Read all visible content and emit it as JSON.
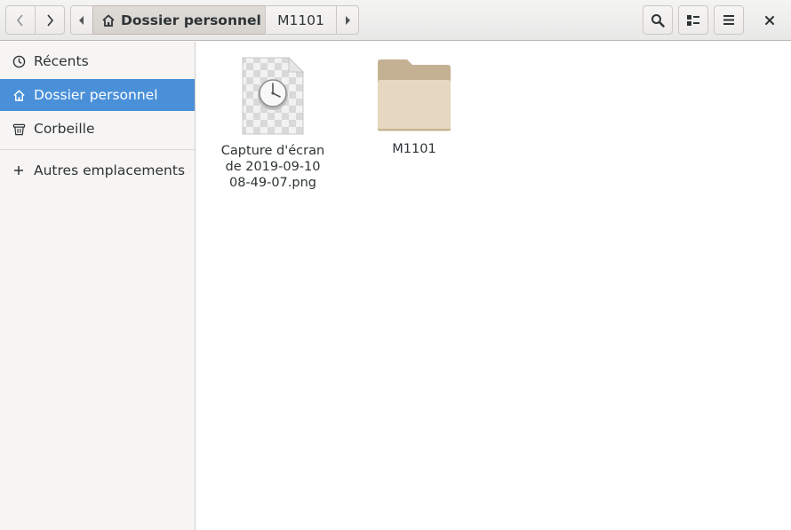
{
  "header": {
    "back_icon": "chevron-left-icon",
    "forward_icon": "chevron-right-icon",
    "path": {
      "home_label": "Dossier personnel",
      "current_label": "M1101"
    },
    "search_icon": "search-icon",
    "view_icon": "view-toggle-icon",
    "menu_icon": "hamburger-menu-icon",
    "close_icon": "close-icon"
  },
  "sidebar": {
    "items": [
      {
        "label": "Récents",
        "icon": "clock-icon",
        "selected": false
      },
      {
        "label": "Dossier personnel",
        "icon": "home-icon",
        "selected": true
      },
      {
        "label": "Corbeille",
        "icon": "trash-icon",
        "selected": false
      },
      {
        "label": "Autres emplacements",
        "icon": "plus-icon",
        "selected": false
      }
    ]
  },
  "files": [
    {
      "name": "Capture d'écran\nde 2019-09-10\n08-49-07.png",
      "type": "image"
    },
    {
      "name": "M1101",
      "type": "folder"
    }
  ],
  "colors": {
    "selection": "#4a90d9",
    "folder": "#e6d8c0",
    "folder_tab": "#c4b193"
  }
}
